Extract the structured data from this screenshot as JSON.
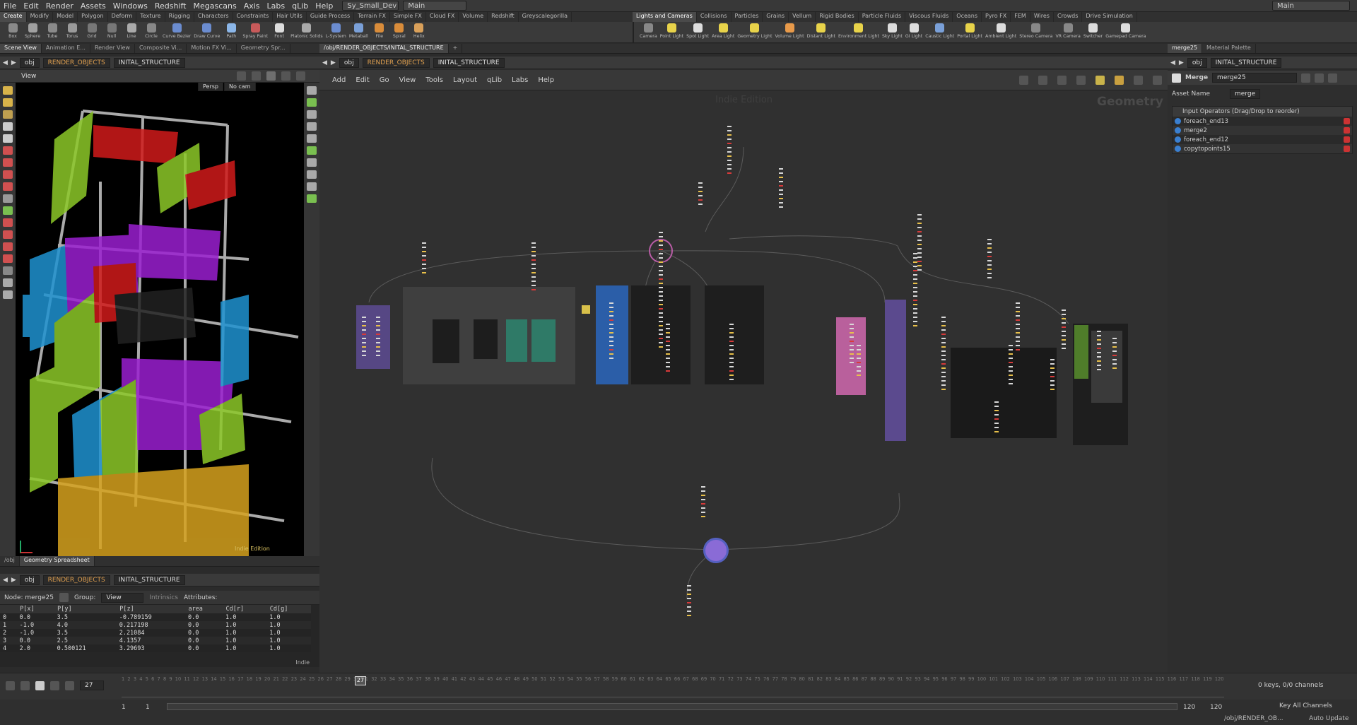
{
  "menu": {
    "items": [
      "File",
      "Edit",
      "Render",
      "Assets",
      "Windows",
      "Redshift",
      "Megascans",
      "Axis",
      "Labs",
      "qLib",
      "Help"
    ],
    "desktop": "Sy_Small_Dev",
    "main": "Main",
    "right": "Main"
  },
  "shelf_tabs": [
    "Create",
    "Modify",
    "Model",
    "Polygon",
    "Deform",
    "Texture",
    "Rigging",
    "Characters",
    "Constraints",
    "Hair Utils",
    "Guide Process",
    "Terrain FX",
    "Simple FX",
    "Cloud FX",
    "Volume",
    "Redshift",
    "Greyscalegorilla"
  ],
  "shelf_tabs_right": [
    "Lights and Cameras",
    "Collisions",
    "Particles",
    "Grains",
    "Vellum",
    "Rigid Bodies",
    "Particle Fluids",
    "Viscous Fluids",
    "Oceans",
    "Pyro FX",
    "FEM",
    "Wires",
    "Crowds",
    "Drive Simulation"
  ],
  "tools_left": [
    {
      "label": "Box",
      "icon": "box-icon",
      "color": "#8a8a8a"
    },
    {
      "label": "Sphere",
      "icon": "sphere-icon",
      "color": "#a0a0a0"
    },
    {
      "label": "Tube",
      "icon": "tube-icon",
      "color": "#8a8a8a"
    },
    {
      "label": "Torus",
      "icon": "torus-icon",
      "color": "#9a9a9a"
    },
    {
      "label": "Grid",
      "icon": "grid-icon",
      "color": "#777"
    },
    {
      "label": "Null",
      "icon": "null-icon",
      "color": "#777"
    },
    {
      "label": "Line",
      "icon": "line-icon",
      "color": "#aaa"
    },
    {
      "label": "Circle",
      "icon": "circle-icon",
      "color": "#888"
    },
    {
      "label": "Curve Bezier",
      "icon": "curve-bezier-icon",
      "color": "#6b8ccf"
    },
    {
      "label": "Draw Curve",
      "icon": "draw-curve-icon",
      "color": "#6b8ccf"
    },
    {
      "label": "Path",
      "icon": "path-icon",
      "color": "#8bb6e8"
    },
    {
      "label": "Spray Paint",
      "icon": "spray-paint-icon",
      "color": "#c85a5a"
    },
    {
      "label": "Font",
      "icon": "font-icon",
      "color": "#ddd"
    },
    {
      "label": "Platonic Solids",
      "icon": "platonic-icon",
      "color": "#aaa"
    },
    {
      "label": "L-System",
      "icon": "l-system-icon",
      "color": "#6b8ccf"
    },
    {
      "label": "Metaball",
      "icon": "metaball-icon",
      "color": "#7aa0d8"
    },
    {
      "label": "File",
      "icon": "file-icon",
      "color": "#d98c3a"
    },
    {
      "label": "Spiral",
      "icon": "spiral-icon",
      "color": "#d98c3a"
    },
    {
      "label": "Helix",
      "icon": "helix-icon",
      "color": "#d9a05a"
    }
  ],
  "tools_right": [
    {
      "label": "Camera",
      "icon": "camera-icon",
      "color": "#888"
    },
    {
      "label": "Point Light",
      "icon": "point-light-icon",
      "color": "#e8d34a"
    },
    {
      "label": "Spot Light",
      "icon": "spot-light-icon",
      "color": "#ddd"
    },
    {
      "label": "Area Light",
      "icon": "area-light-icon",
      "color": "#e8d34a"
    },
    {
      "label": "Geometry Light",
      "icon": "geometry-light-icon",
      "color": "#e8d34a"
    },
    {
      "label": "Volume Light",
      "icon": "volume-light-icon",
      "color": "#e89a4a"
    },
    {
      "label": "Distant Light",
      "icon": "distant-light-icon",
      "color": "#e8d34a"
    },
    {
      "label": "Environment Light",
      "icon": "env-light-icon",
      "color": "#e8d34a"
    },
    {
      "label": "Sky Light",
      "icon": "sky-light-icon",
      "color": "#ddd"
    },
    {
      "label": "GI Light",
      "icon": "gi-light-icon",
      "color": "#ddd"
    },
    {
      "label": "Caustic Light",
      "icon": "caustic-light-icon",
      "color": "#7aa0d8"
    },
    {
      "label": "Portal Light",
      "icon": "portal-light-icon",
      "color": "#e8d34a"
    },
    {
      "label": "Ambient Light",
      "icon": "ambient-light-icon",
      "color": "#ddd"
    },
    {
      "label": "Stereo Camera",
      "icon": "stereo-camera-icon",
      "color": "#888"
    },
    {
      "label": "VR Camera",
      "icon": "vr-camera-icon",
      "color": "#888"
    },
    {
      "label": "Switcher",
      "icon": "switcher-icon",
      "color": "#ddd"
    },
    {
      "label": "Gamepad Camera",
      "icon": "gamepad-camera-icon",
      "color": "#ddd"
    }
  ],
  "left_tabs": [
    "Scene View",
    "Animation E...",
    "Render View",
    "Composite Vi...",
    "Motion FX Vi...",
    "Geometry Spr..."
  ],
  "path": {
    "obj": "obj",
    "render": "RENDER_OBJECTS",
    "initial": "INITAL_STRUCTURE"
  },
  "viewport": {
    "label": "View",
    "persp": "Persp",
    "cam": "No cam",
    "watermark": "Indie Edition"
  },
  "net_tab": "/obj/RENDER_OBJECTS/INITAL_STRUCTURE",
  "net_menu": [
    "Add",
    "Edit",
    "Go",
    "View",
    "Tools",
    "Layout",
    "qLib",
    "Labs",
    "Help"
  ],
  "net_watermark": "Indie Edition",
  "net_context": "Geometry",
  "param": {
    "tabs": [
      "merge25",
      "Material Palette"
    ],
    "type": "Merge",
    "name": "merge25",
    "asset_label": "Asset Name",
    "asset_value": "merge",
    "input_header": "Input Operators (Drag/Drop to reorder)",
    "inputs": [
      "foreach_end13",
      "merge2",
      "foreach_end12",
      "copytopoints15"
    ]
  },
  "sheet": {
    "tabs": [
      "/obj",
      "Geometry Spreadsheet"
    ],
    "node": "Node: merge25",
    "group": "Group:",
    "view": "View",
    "intrinsics": "Intrinsics",
    "attributes": "Attributes:",
    "headers": [
      "",
      "P[x]",
      "P[y]",
      "P[z]",
      "area",
      "Cd[r]",
      "Cd[g]"
    ],
    "rows": [
      [
        "0",
        "0.0",
        "3.5",
        "-0.789159",
        "0.0",
        "1.0",
        "1.0"
      ],
      [
        "1",
        "-1.0",
        "4.0",
        "0.217198",
        "0.0",
        "1.0",
        "1.0"
      ],
      [
        "2",
        "-1.0",
        "3.5",
        "2.21084",
        "0.0",
        "1.0",
        "1.0"
      ],
      [
        "3",
        "0.0",
        "2.5",
        "4.1357",
        "0.0",
        "1.0",
        "1.0"
      ],
      [
        "4",
        "2.0",
        "0.500121",
        "3.29693",
        "0.0",
        "1.0",
        "1.0"
      ]
    ],
    "indie": "Indie"
  },
  "timeline": {
    "frame": "27",
    "start": "1",
    "start2": "1",
    "end": "120",
    "end2": "120",
    "keys": "0 keys, 0/0 channels",
    "key_all": "Key All Channels",
    "status_path": "/obj/RENDER_OB...",
    "auto_update": "Auto Update",
    "ticks": [
      "1",
      "2",
      "3",
      "4",
      "5",
      "6",
      "7",
      "8",
      "9",
      "10",
      "11",
      "12",
      "13",
      "14",
      "15",
      "16",
      "17",
      "18",
      "19",
      "20",
      "21",
      "22",
      "23",
      "24",
      "25",
      "26",
      "27",
      "28",
      "29",
      "30",
      "31",
      "32",
      "33",
      "34",
      "35",
      "36",
      "37",
      "38",
      "39",
      "40",
      "41",
      "42",
      "43",
      "44",
      "45",
      "46",
      "47",
      "48",
      "49",
      "50",
      "51",
      "52",
      "53",
      "54",
      "55",
      "56",
      "57",
      "58",
      "59",
      "60",
      "61",
      "62",
      "63",
      "64",
      "65",
      "66",
      "67",
      "68",
      "69",
      "70",
      "71",
      "72",
      "73",
      "74",
      "75",
      "76",
      "77",
      "78",
      "79",
      "80",
      "81",
      "82",
      "83",
      "84",
      "85",
      "86",
      "87",
      "88",
      "89",
      "90",
      "91",
      "92",
      "93",
      "94",
      "95",
      "96",
      "97",
      "98",
      "99",
      "100",
      "101",
      "102",
      "103",
      "104",
      "105",
      "106",
      "107",
      "108",
      "109",
      "110",
      "111",
      "112",
      "113",
      "114",
      "115",
      "116",
      "117",
      "118",
      "119",
      "120"
    ]
  }
}
